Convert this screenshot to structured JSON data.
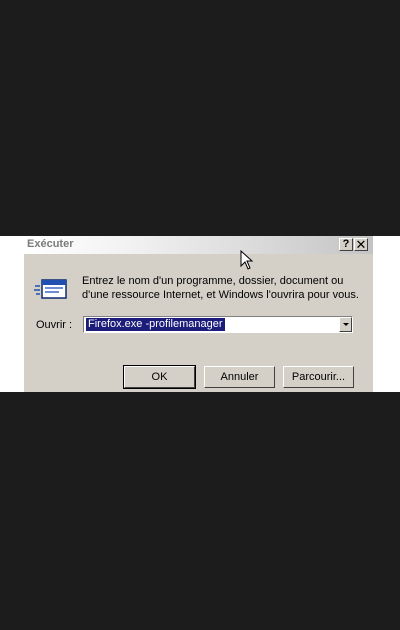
{
  "window": {
    "title": "Exécuter",
    "help_button": "?",
    "close_button": "✕"
  },
  "description": "Entrez le nom d'un programme, dossier, document ou d'une ressource Internet, et Windows l'ouvrira pour vous.",
  "open_field": {
    "label": "Ouvrir :",
    "value": "Firefox.exe -profilemanager"
  },
  "buttons": {
    "ok": "OK",
    "cancel": "Annuler",
    "browse": "Parcourir..."
  },
  "icons": {
    "run": "run-program-icon",
    "cursor": "mouse-pointer-icon"
  }
}
